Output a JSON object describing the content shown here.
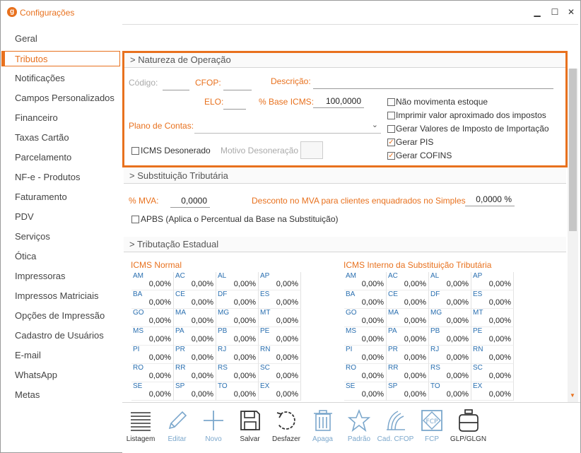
{
  "window": {
    "app_icon": "g",
    "title": "Configurações",
    "minimize": "▁",
    "maximize": "☐",
    "close": "✕"
  },
  "sidebar": {
    "items": [
      {
        "label": "Geral"
      },
      {
        "label": "Tributos",
        "active": true
      },
      {
        "label": "Notificações"
      },
      {
        "label": "Campos Personalizados"
      },
      {
        "label": "Financeiro"
      },
      {
        "label": "Taxas Cartão"
      },
      {
        "label": "Parcelamento"
      },
      {
        "label": "NF-e - Produtos"
      },
      {
        "label": "Faturamento"
      },
      {
        "label": "PDV"
      },
      {
        "label": "Serviços"
      },
      {
        "label": "Ótica"
      },
      {
        "label": "Impressoras"
      },
      {
        "label": "Impressos Matriciais"
      },
      {
        "label": "Opções de Impressão"
      },
      {
        "label": "Cadastro de Usuários"
      },
      {
        "label": "E-mail"
      },
      {
        "label": "WhatsApp"
      },
      {
        "label": "Metas"
      }
    ]
  },
  "natureza": {
    "header": "> Natureza de Operação",
    "codigo_label": "Código:",
    "cfop_label": "CFOP:",
    "descricao_label": "Descrição:",
    "elo_label": "ELO:",
    "base_icms_label": "% Base ICMS:",
    "base_icms_value": "100,0000",
    "plano_label": "Plano de Contas:",
    "plano_value": "",
    "icms_desonerado_label": "ICMS Desonerado",
    "icms_desonerado_checked": false,
    "motivo_label": "Motivo Desoneração",
    "options": [
      {
        "label": "Não movimenta estoque",
        "checked": false
      },
      {
        "label": "Imprimir valor aproximado dos impostos",
        "checked": false
      },
      {
        "label": "Gerar Valores de Imposto de Importação",
        "checked": false
      },
      {
        "label": "Gerar PIS",
        "checked": true
      },
      {
        "label": "Gerar COFINS",
        "checked": true
      }
    ]
  },
  "substituicao": {
    "header": "> Substituição Tributária",
    "mva_label": "% MVA:",
    "mva_value": "0,0000",
    "desconto_label": "Desconto no MVA para clientes enquadrados no Simples",
    "desconto_value": "0,0000 %",
    "apbs_label": "APBS (Aplica o Percentual da Base na Substituição)",
    "apbs_checked": false
  },
  "estadual": {
    "header": "> Tributação Estadual",
    "icms_normal_title": "ICMS Normal",
    "icms_interno_title": "ICMS Interno da Substituição Tributária",
    "states": [
      "AM",
      "AC",
      "AL",
      "AP",
      "BA",
      "CE",
      "DF",
      "ES",
      "GO",
      "MA",
      "MG",
      "MT",
      "MS",
      "PA",
      "PB",
      "PE",
      "PI",
      "PR",
      "RJ",
      "RN",
      "RO",
      "RR",
      "RS",
      "SC",
      "SE",
      "SP",
      "TO",
      "EX"
    ],
    "value": "0,00%"
  },
  "toolbar": {
    "buttons": [
      {
        "label": "Listagem",
        "icon": "list-icon",
        "enabled": true
      },
      {
        "label": "Editar",
        "icon": "pencil-icon",
        "enabled": false
      },
      {
        "label": "Novo",
        "icon": "plus-icon",
        "enabled": false
      },
      {
        "label": "Salvar",
        "icon": "floppy-icon",
        "enabled": true
      },
      {
        "label": "Desfazer",
        "icon": "undo-icon",
        "enabled": true
      },
      {
        "label": "Apaga",
        "icon": "trash-icon",
        "enabled": false
      },
      {
        "label": "Padrão",
        "icon": "star-icon",
        "enabled": false
      },
      {
        "label": "Cad. CFOP",
        "icon": "cfop-icon",
        "enabled": false
      },
      {
        "label": "FCP",
        "icon": "fcp-icon",
        "enabled": false
      },
      {
        "label": "GLP/GLGN",
        "icon": "gas-cylinder-icon",
        "enabled": true
      }
    ]
  },
  "colors": {
    "accent": "#e8711e",
    "link_blue": "#2a6fb0",
    "disabled_icon": "#7ba7cc"
  }
}
